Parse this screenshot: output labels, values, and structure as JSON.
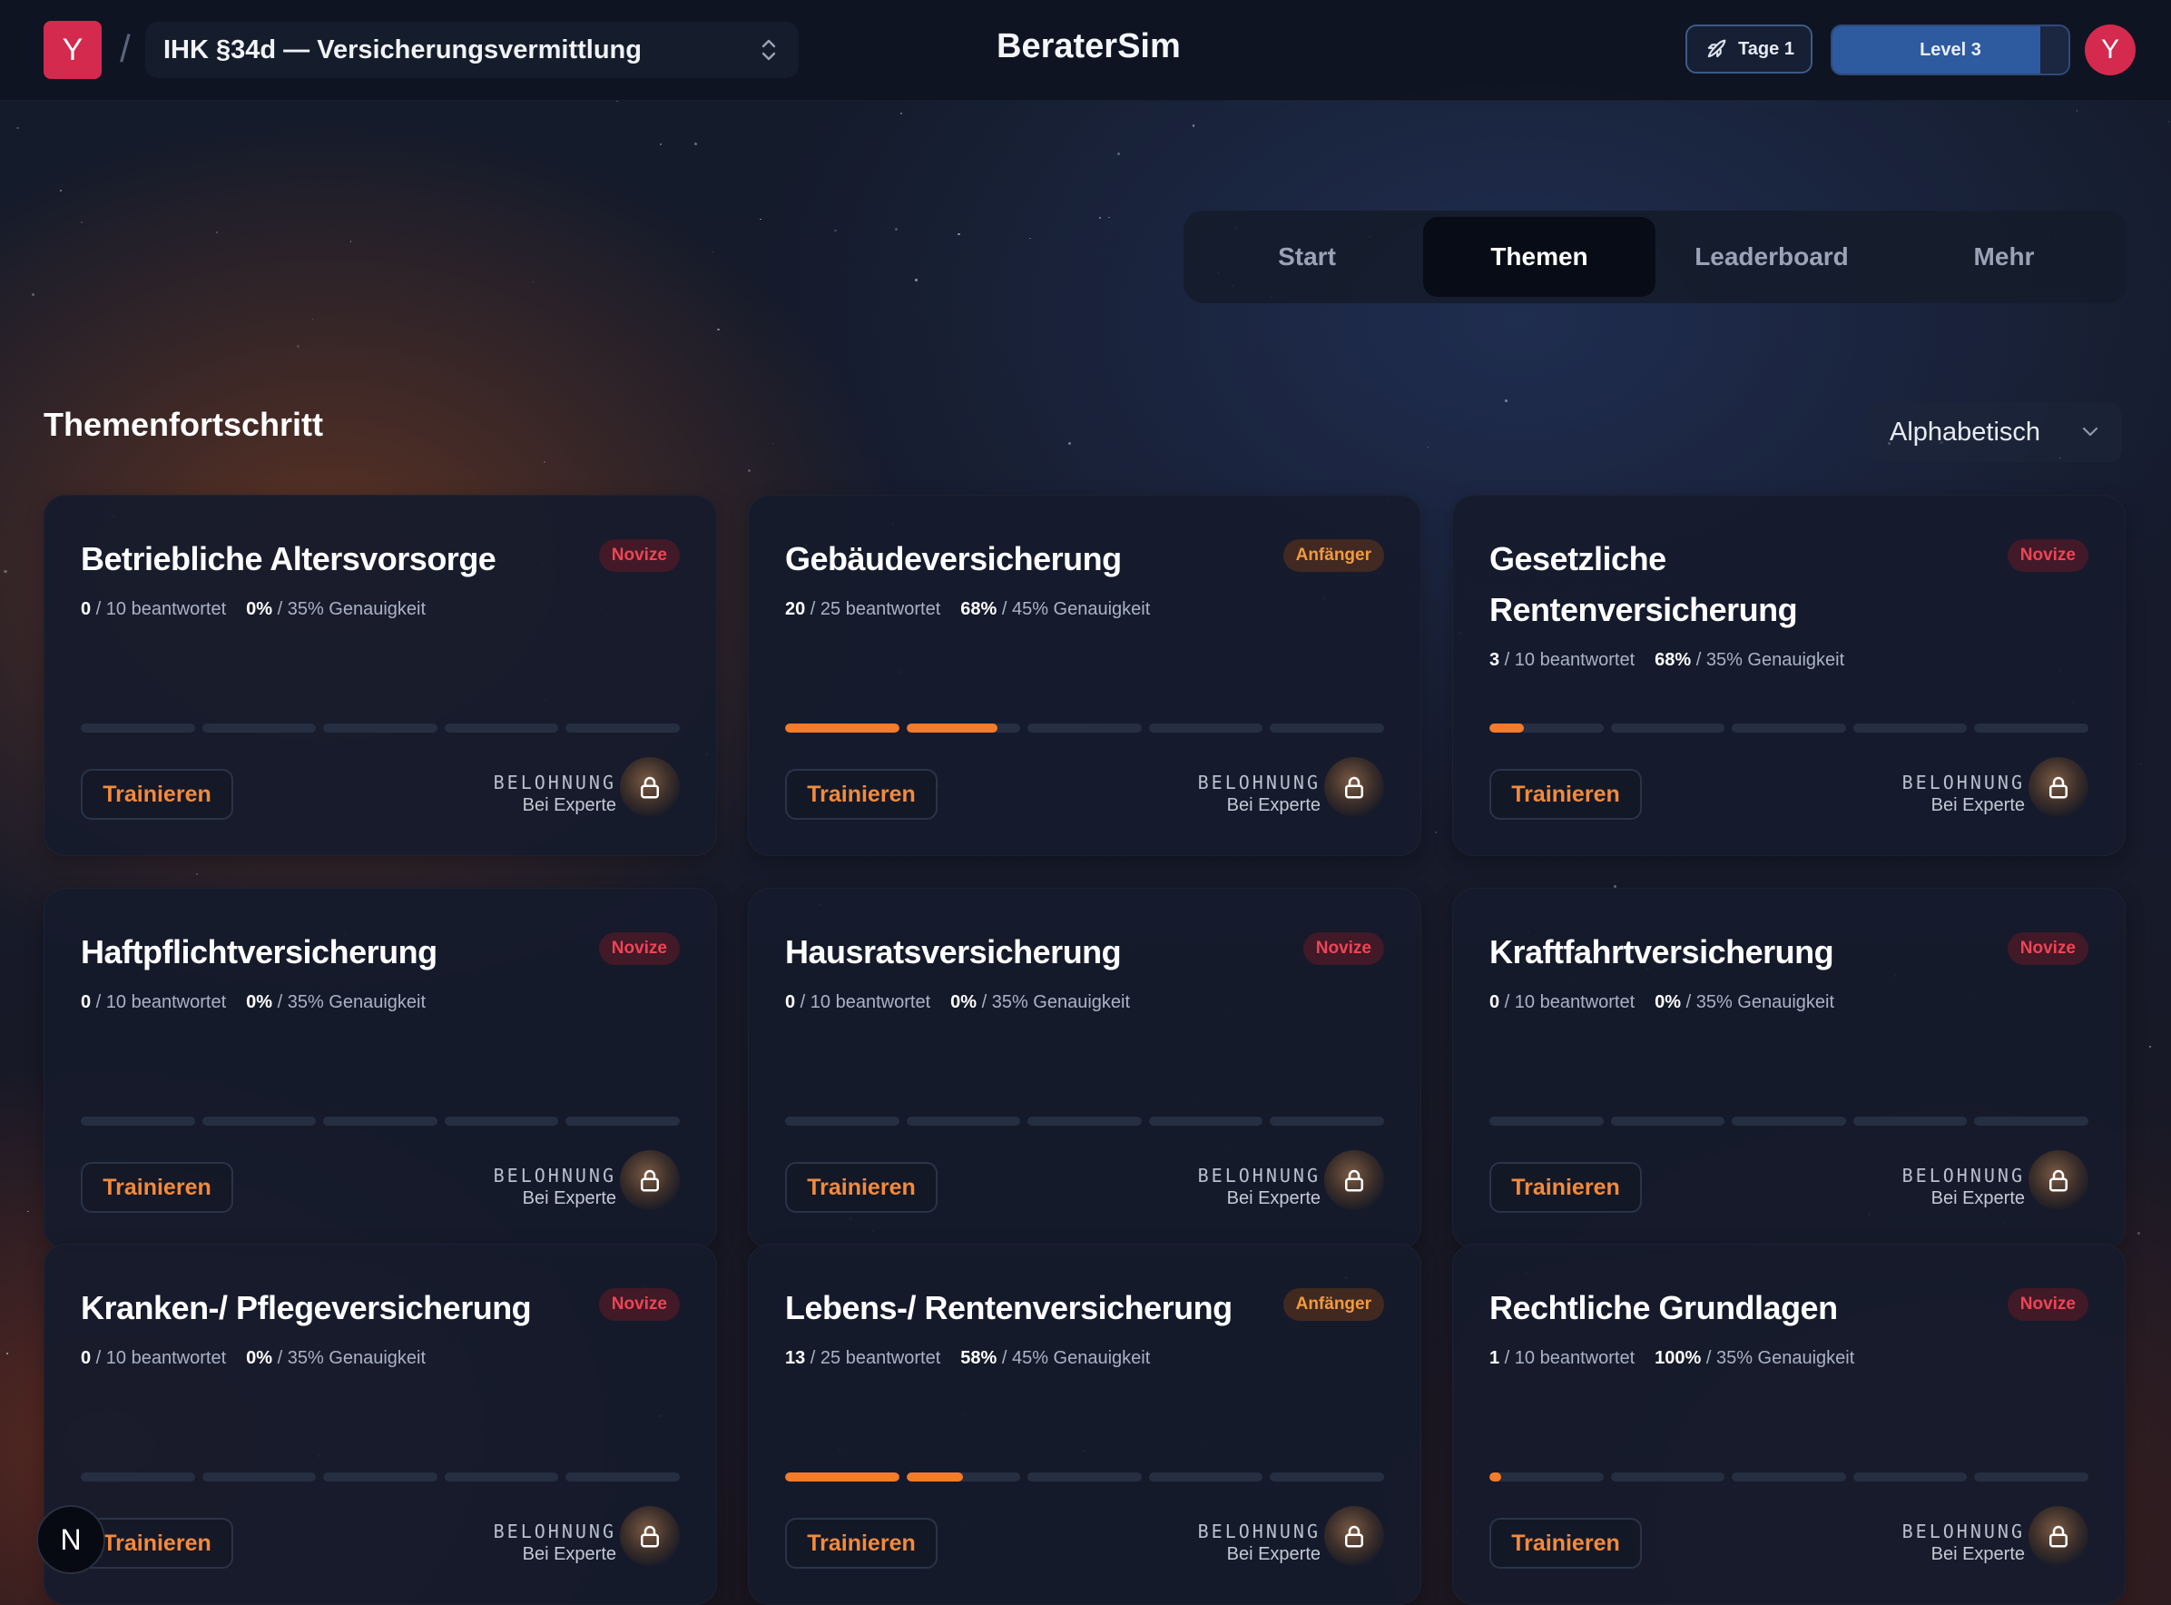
{
  "header": {
    "logo_letter": "Y",
    "separator": "/",
    "course_title": "IHK §34d — Versicherungsvermittlung",
    "brand": "BeraterSim",
    "days_label": "Tage 1",
    "level_label": "Level 3",
    "level_progress": 0.88,
    "avatar_letter": "Y"
  },
  "tabs": [
    {
      "label": "Start",
      "active": false
    },
    {
      "label": "Themen",
      "active": true
    },
    {
      "label": "Leaderboard",
      "active": false
    },
    {
      "label": "Mehr",
      "active": false
    }
  ],
  "section": {
    "title": "Themenfortschritt",
    "sort_label": "Alphabetisch"
  },
  "colors": {
    "accent_orange": "#f47b2a",
    "novice_red": "#ef4454",
    "beginner_orange": "#f39a3d",
    "logo_red": "#d42a4e",
    "level_blue": "#2e5aa0"
  },
  "card_labels": {
    "answered_suffix": "beantwortet",
    "accuracy_suffix": "Genauigkeit",
    "train_button": "Trainieren",
    "reward_label": "BELOHNUNG",
    "reward_sub": "Bei Experte"
  },
  "topics": [
    {
      "title": "Betriebliche Altersvorsorge",
      "badge": "Novize",
      "level": "novice",
      "answered": "0",
      "total": "10",
      "accuracy": "0%",
      "target": "35%",
      "segments": [
        0,
        0,
        0,
        0,
        0
      ]
    },
    {
      "title": "Gebäudeversicherung",
      "badge": "Anfänger",
      "level": "beginner",
      "answered": "20",
      "total": "25",
      "accuracy": "68%",
      "target": "45%",
      "segments": [
        1,
        0.8,
        0,
        0,
        0
      ]
    },
    {
      "title": "Gesetzliche Rentenversicherung",
      "badge": "Novize",
      "level": "novice",
      "answered": "3",
      "total": "10",
      "accuracy": "68%",
      "target": "35%",
      "segments": [
        0.3,
        0,
        0,
        0,
        0
      ]
    },
    {
      "title": "Haftpflichtversicherung",
      "badge": "Novize",
      "level": "novice",
      "answered": "0",
      "total": "10",
      "accuracy": "0%",
      "target": "35%",
      "segments": [
        0,
        0,
        0,
        0,
        0
      ]
    },
    {
      "title": "Hausratsversicherung",
      "badge": "Novize",
      "level": "novice",
      "answered": "0",
      "total": "10",
      "accuracy": "0%",
      "target": "35%",
      "segments": [
        0,
        0,
        0,
        0,
        0
      ]
    },
    {
      "title": "Kraftfahrtversicherung",
      "badge": "Novize",
      "level": "novice",
      "answered": "0",
      "total": "10",
      "accuracy": "0%",
      "target": "35%",
      "segments": [
        0,
        0,
        0,
        0,
        0
      ]
    },
    {
      "title": "Kranken-/ Pflegeversicherung",
      "badge": "Novize",
      "level": "novice",
      "answered": "0",
      "total": "10",
      "accuracy": "0%",
      "target": "35%",
      "segments": [
        0,
        0,
        0,
        0,
        0
      ]
    },
    {
      "title": "Lebens-/ Rentenversicherung",
      "badge": "Anfänger",
      "level": "beginner",
      "answered": "13",
      "total": "25",
      "accuracy": "58%",
      "target": "45%",
      "segments": [
        1,
        0.5,
        0,
        0,
        0
      ]
    },
    {
      "title": "Rechtliche Grundlagen",
      "badge": "Novize",
      "level": "novice",
      "answered": "1",
      "total": "10",
      "accuracy": "100%",
      "target": "35%",
      "segments": [
        0.1,
        0,
        0,
        0,
        0
      ]
    }
  ],
  "dev_badge": "N"
}
